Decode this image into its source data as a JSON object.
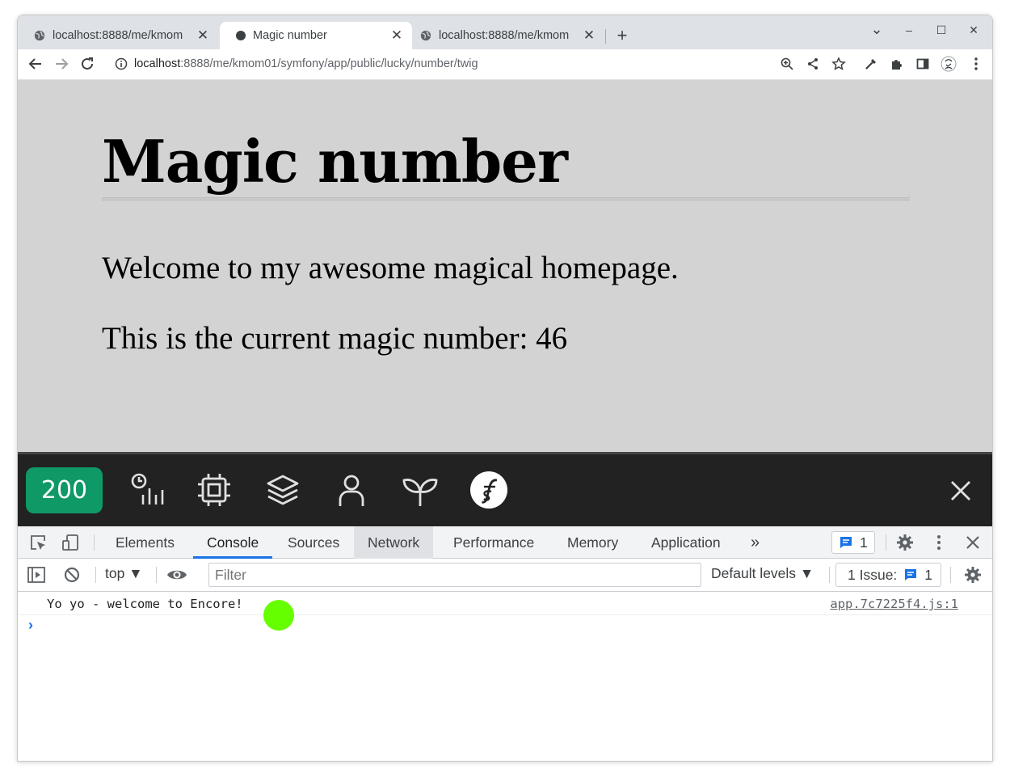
{
  "browser": {
    "tabs": [
      {
        "title": "localhost:8888/me/kmom",
        "close": "✕"
      },
      {
        "title": "Magic number",
        "close": "✕"
      },
      {
        "title": "localhost:8888/me/kmom",
        "close": "✕"
      }
    ],
    "new_tab": "+",
    "window_controls": {
      "dropdown": "⌄",
      "minimize": "–",
      "maximize": "☐",
      "close": "✕"
    },
    "url_host": "localhost",
    "url_path": ":8888/me/kmom01/symfony/app/public/lucky/number/twig"
  },
  "page": {
    "heading": "Magic number",
    "welcome": "Welcome to my awesome magical homepage.",
    "magic_line": "This is the current magic number: 46"
  },
  "symfony_toolbar": {
    "status_code": "200",
    "accent": "#0f9967"
  },
  "devtools": {
    "tabs": [
      "Elements",
      "Console",
      "Sources",
      "Network",
      "Performance",
      "Memory",
      "Application"
    ],
    "more_tabs": "»",
    "message_count": "1",
    "context": "top ▼",
    "filter_placeholder": "Filter",
    "levels": "Default levels ▼",
    "issues_label": "1 Issue:",
    "issues_count": "1",
    "console_messages": [
      {
        "text": "Yo yo - welcome to Encore!",
        "source": "app.7c7225f4.js:1"
      }
    ],
    "prompt": "›"
  }
}
